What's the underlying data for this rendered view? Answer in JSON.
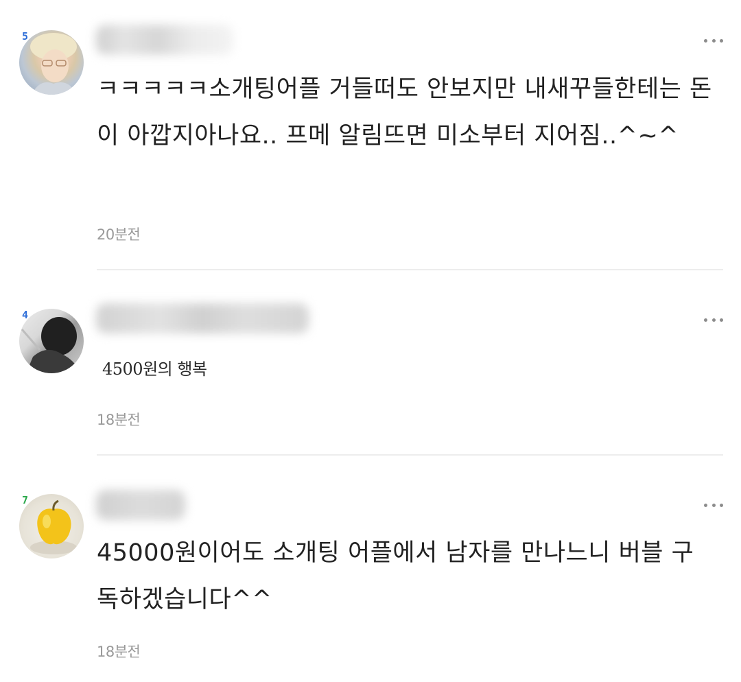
{
  "comments": [
    {
      "level": "5",
      "level_color": "#2f6fd8",
      "avatar_icon": "user-photo-avatar",
      "text": "ㅋㅋㅋㅋㅋ소개팅어플 거들떠도 안보지만 내새꾸들한테는 돈이 아깝지아나요.. 프메 알림뜨면 미소부터 지어짐..^~^",
      "time": "20분전"
    },
    {
      "level": "4",
      "level_color": "#2f6fd8",
      "avatar_icon": "user-photo-avatar",
      "text": "4500원의 행복",
      "time": "18분전"
    },
    {
      "level": "7",
      "level_color": "#2aa84a",
      "avatar_icon": "apple-avatar",
      "text": "45000원이어도 소개팅 어플에서 남자를 만나느니 버블 구독하겠습니다^^",
      "time": "18분전"
    }
  ],
  "more_icon": "more-horizontal-icon"
}
